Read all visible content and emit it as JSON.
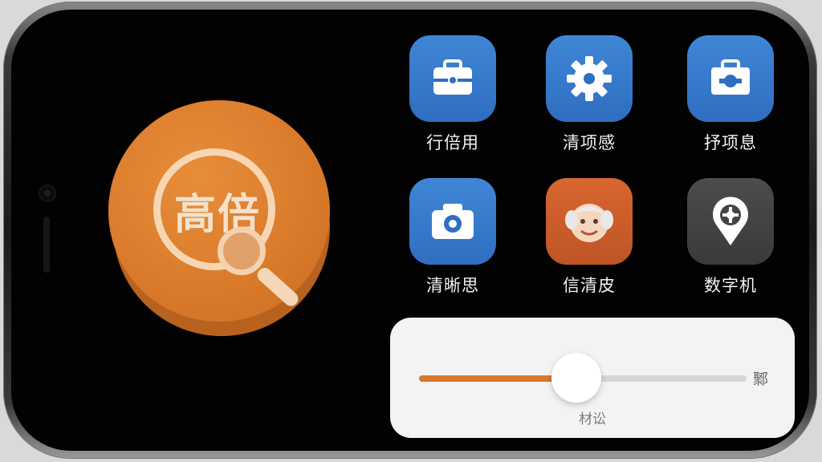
{
  "magnifier": {
    "label": "高倍",
    "color": "#d97a2a"
  },
  "apps": [
    {
      "label": "行倍用",
      "icon": "briefcase-icon",
      "color": "#3a7fd0"
    },
    {
      "label": "清项感",
      "icon": "gear-icon",
      "color": "#3a7fd0"
    },
    {
      "label": "抒项息",
      "icon": "toolbox-icon",
      "color": "#3a7fd0"
    },
    {
      "label": "清晰思",
      "icon": "camera-icon",
      "color": "#3a7fd0"
    },
    {
      "label": "信清皮",
      "icon": "grandpa-face-icon",
      "color": "#cf5b2a"
    },
    {
      "label": "数字机",
      "icon": "map-pin-icon",
      "color": "#444444"
    }
  ],
  "slider": {
    "value": 0.48,
    "end_label": "鄹",
    "caption": "材讼",
    "accent": "#d9782d"
  }
}
